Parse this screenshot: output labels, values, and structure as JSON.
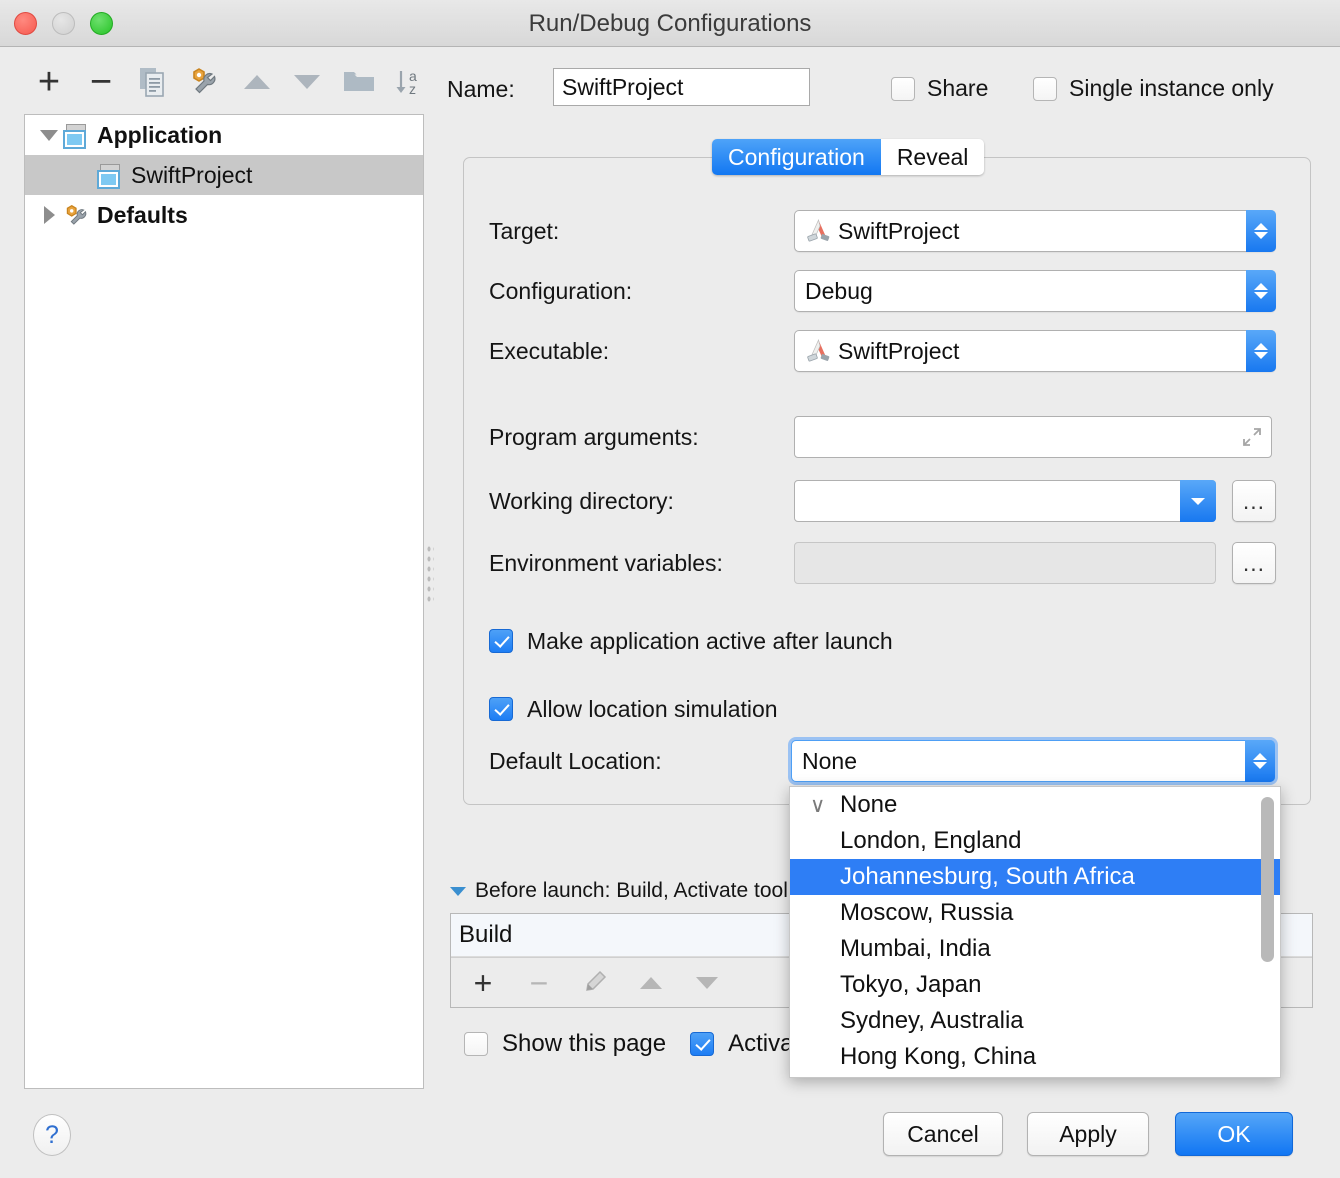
{
  "window": {
    "title": "Run/Debug Configurations",
    "traffic_lights": [
      "close",
      "minimize",
      "maximize"
    ]
  },
  "left_toolbar": {
    "buttons": [
      {
        "name": "add",
        "icon": "plus-icon",
        "label": "+"
      },
      {
        "name": "remove",
        "icon": "minus-icon",
        "label": "−"
      },
      {
        "name": "copy",
        "icon": "copy-configuration-icon",
        "label": ""
      },
      {
        "name": "edit-defaults",
        "icon": "wrench-gear-icon",
        "label": ""
      },
      {
        "name": "move-up",
        "icon": "arrow-up-icon",
        "label": ""
      },
      {
        "name": "move-down",
        "icon": "arrow-down-icon",
        "label": ""
      },
      {
        "name": "create-folder",
        "icon": "folder-icon",
        "label": ""
      },
      {
        "name": "sort-alphabetically",
        "icon": "sort-az-icon",
        "label": ""
      }
    ]
  },
  "tree": {
    "nodes": [
      {
        "label": "Application",
        "icon": "application-icon",
        "expanded": true,
        "bold": true,
        "indent": 0,
        "selected": false
      },
      {
        "label": "SwiftProject",
        "icon": "application-icon",
        "expanded": null,
        "bold": false,
        "indent": 1,
        "selected": true
      },
      {
        "label": "Defaults",
        "icon": "wrench-gear-icon",
        "expanded": false,
        "bold": true,
        "indent": 0,
        "selected": false
      }
    ]
  },
  "name_row": {
    "label": "Name:",
    "value": "SwiftProject",
    "placeholder": "",
    "share": {
      "label": "Share",
      "checked": false
    },
    "single_instance": {
      "label": "Single instance only",
      "checked": false
    }
  },
  "tabs": [
    {
      "label": "Configuration",
      "active": true
    },
    {
      "label": "Reveal",
      "active": false
    }
  ],
  "configuration": {
    "target": {
      "label": "Target:",
      "value": "SwiftProject",
      "icon": "xcode-target-icon"
    },
    "build_configuration": {
      "label": "Configuration:",
      "value": "Debug"
    },
    "executable": {
      "label": "Executable:",
      "value": "SwiftProject",
      "icon": "xcode-target-icon"
    },
    "program_arguments": {
      "label": "Program arguments:",
      "value": "",
      "placeholder": ""
    },
    "working_directory": {
      "label": "Working directory:",
      "value": "",
      "placeholder": "",
      "browse_label": "..."
    },
    "environment_variables": {
      "label": "Environment variables:",
      "value": "",
      "placeholder": "",
      "browse_label": "...",
      "disabled": true
    },
    "make_app_active": {
      "label": "Make application active after launch",
      "checked": true
    },
    "allow_location_simulation": {
      "label": "Allow location simulation",
      "checked": true
    },
    "default_location": {
      "label": "Default Location:",
      "value": "None"
    }
  },
  "location_dropdown": {
    "open": true,
    "options": [
      {
        "label": "None",
        "checked": true,
        "highlighted": false
      },
      {
        "label": "London, England",
        "checked": false,
        "highlighted": false
      },
      {
        "label": "Johannesburg, South Africa",
        "checked": false,
        "highlighted": true
      },
      {
        "label": "Moscow, Russia",
        "checked": false,
        "highlighted": false
      },
      {
        "label": "Mumbai, India",
        "checked": false,
        "highlighted": false
      },
      {
        "label": "Tokyo, Japan",
        "checked": false,
        "highlighted": false
      },
      {
        "label": "Sydney, Australia",
        "checked": false,
        "highlighted": false
      },
      {
        "label": "Hong Kong, China",
        "checked": false,
        "highlighted": false
      }
    ]
  },
  "before_launch": {
    "header": "Before launch: Build, Activate tool window",
    "rows": [
      "Build"
    ],
    "toolbar": [
      {
        "name": "add-task",
        "icon": "plus-icon",
        "label": "+",
        "enabled": true
      },
      {
        "name": "remove-task",
        "icon": "minus-icon",
        "label": "−",
        "enabled": false
      },
      {
        "name": "edit-task",
        "icon": "pencil-icon",
        "label": "",
        "enabled": false
      },
      {
        "name": "move-task-up",
        "icon": "arrow-up-icon",
        "label": "",
        "enabled": false
      },
      {
        "name": "move-task-down",
        "icon": "arrow-down-icon",
        "label": "",
        "enabled": false
      }
    ],
    "show_this_page": {
      "label": "Show this page",
      "checked": false
    },
    "activate_tool_window": {
      "label": "Activate tool window",
      "checked": true
    }
  },
  "footer": {
    "help_label": "?",
    "cancel_label": "Cancel",
    "apply_label": "Apply",
    "ok_label": "OK"
  },
  "colors": {
    "accent_blue": "#2e7ef5",
    "window_bg": "#ececec",
    "selection_gray": "#c8c8c8",
    "tab_active": "#1277f2"
  }
}
